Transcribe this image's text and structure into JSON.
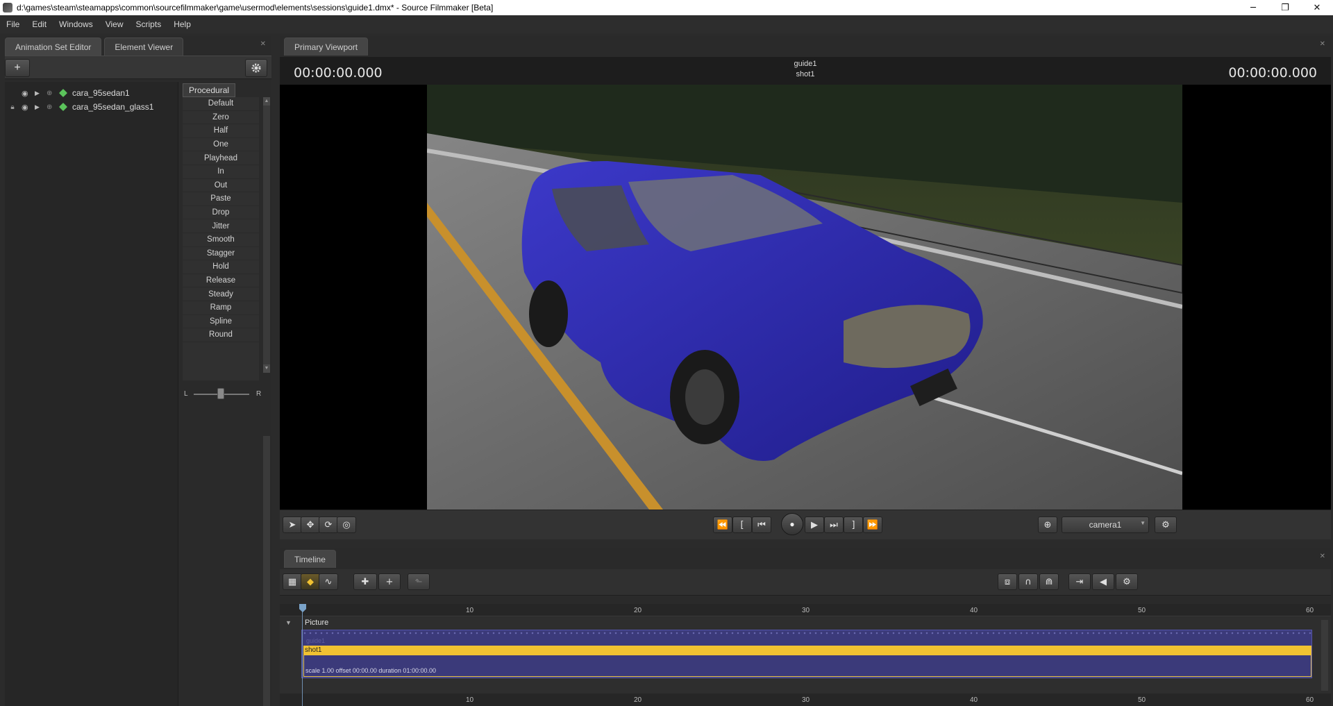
{
  "window": {
    "title": "d:\\games\\steam\\steamapps\\common\\sourcefilmmaker\\game\\usermod\\elements\\sessions\\guide1.dmx* - Source Filmmaker [Beta]",
    "minimize": "─",
    "restore": "❐",
    "close": "✕"
  },
  "menu": [
    "File",
    "Edit",
    "Windows",
    "View",
    "Scripts",
    "Help"
  ],
  "left_panel": {
    "tabs": [
      "Animation Set Editor",
      "Element Viewer"
    ],
    "add_icon": "+",
    "settings_icon": "gear-icon",
    "anim_sets": [
      {
        "label": "cara_95sedan1",
        "locked": false
      },
      {
        "label": "cara_95sedan_glass1",
        "locked": true
      }
    ],
    "procedural_tab": "Procedural",
    "procedural_items": [
      "Default",
      "Zero",
      "Half",
      "One",
      "Playhead",
      "In",
      "Out",
      "Paste",
      "Drop",
      "Jitter",
      "Smooth",
      "Stagger",
      "Hold",
      "Release",
      "Steady",
      "Ramp",
      "Spline",
      "Round"
    ],
    "slider_left": "L",
    "slider_right": "R"
  },
  "viewport": {
    "tab": "Primary Viewport",
    "time_left": "00:00:00.000",
    "time_right": "00:00:00.000",
    "session": "guide1",
    "shot": "shot1",
    "camera": "camera1",
    "colors": {
      "car": "#2f2cb4",
      "road": "#6b6b6b",
      "grass": "#3f4a24",
      "trees": "#1f2a1c"
    }
  },
  "timeline": {
    "tab": "Timeline",
    "ruler_ticks": [
      "10",
      "20",
      "30",
      "40",
      "50",
      "60"
    ],
    "track_label": "Picture",
    "guide_label": "guide1",
    "shot_label": "shot1",
    "clip_info": "scale 1.00 offset  00:00.00 duration  01:00:00.00",
    "colors": {
      "clip": "#3b3a7a",
      "shot": "#f1c232"
    }
  }
}
